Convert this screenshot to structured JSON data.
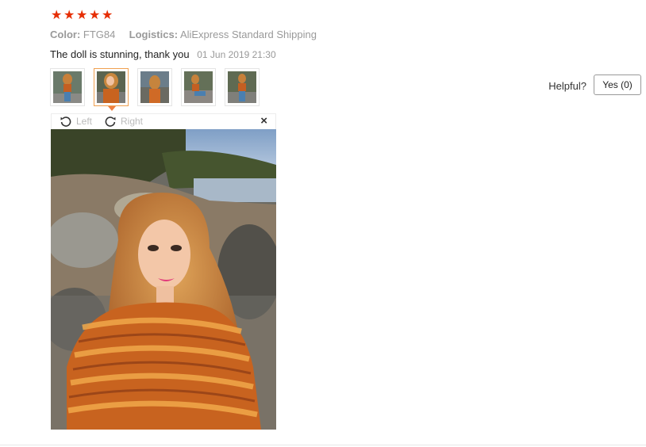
{
  "review": {
    "rating": 5,
    "stars": [
      "★",
      "★",
      "★",
      "★",
      "★"
    ],
    "color_label": "Color:",
    "color_value": "FTG84",
    "logistics_label": "Logistics:",
    "logistics_value": "AliExpress Standard Shipping",
    "text": "The doll is stunning, thank you",
    "date": "01 Jun 2019 21:30",
    "thumbnail_count": 5,
    "selected_thumbnail": 2
  },
  "feedback": {
    "helpful_label": "Helpful?",
    "yes_label": "Yes (0)"
  },
  "viewer": {
    "rotate_left_label": "Left",
    "rotate_right_label": "Right",
    "close_glyph": "×"
  },
  "colors": {
    "star": "#e62e04",
    "active_thumb_border": "#f0a050",
    "muted_text": "#999999"
  }
}
